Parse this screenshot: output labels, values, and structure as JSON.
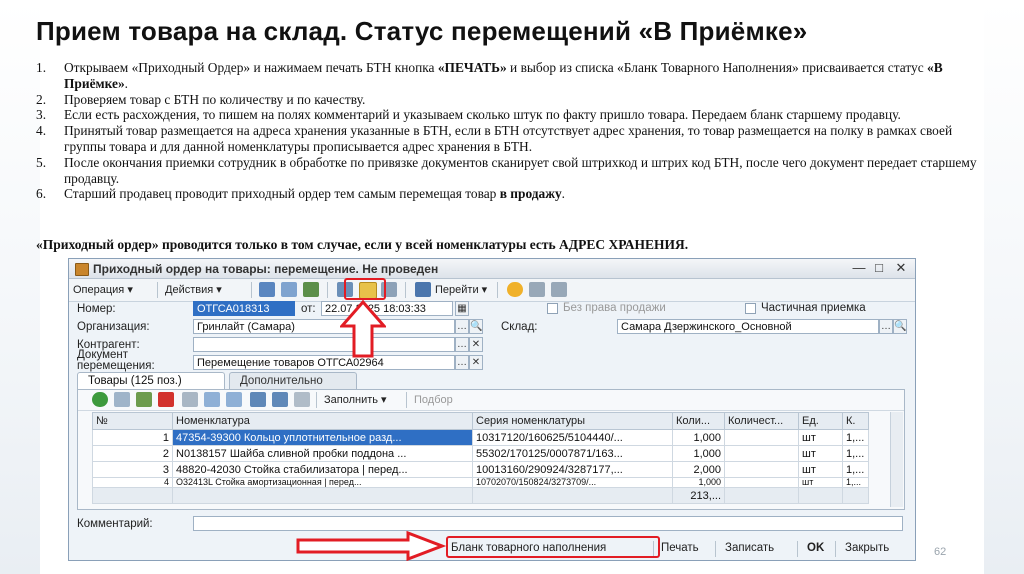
{
  "slide": {
    "title": "Прием товара на склад. Статус перемещений «В Приёмке»",
    "page_number": "62",
    "note": "«Приходный ордер» проводится только в том случае, если у всей номенклатуры есть АДРЕС ХРАНЕНИЯ.",
    "steps": [
      {
        "num": "1.",
        "pre": "Открываем «Приходный Ордер» и нажимаем печать БТН кнопка ",
        "bold1": "«ПЕЧАТЬ»",
        "mid": " и выбор из списка «Бланк Товарного Наполнения» присваивается статус ",
        "bold2": "«В Приёмке»",
        "post": "."
      },
      {
        "num": "2.",
        "text": "Проверяем товар с БТН по количеству и по качеству."
      },
      {
        "num": "3.",
        "text": "Если есть расхождения, то пишем на полях комментарий и указываем сколько штук по факту пришло товара. Передаем бланк старшему продавцу."
      },
      {
        "num": "4.",
        "text": "Принятый товар размещается на адреса хранения указанные в БТН, если в БТН отсутствует адрес хранения, то товар размещается на полку в рамках своей группы товара и для данной номенклатуры прописывается адрес хранения в БТН."
      },
      {
        "num": "5.",
        "text": "После окончания приемки сотрудник в обработке по привязке документов сканирует свой штрихкод и штрих код БТН, после чего документ передает старшему продавцу."
      },
      {
        "num": "6.",
        "pre": "Старший продавец проводит приходный ордер тем самым перемещая товар ",
        "bold1": "в продажу",
        "post": "."
      }
    ]
  },
  "window": {
    "title": "Приходный ордер на товары: перемещение. Не проведен",
    "controls": [
      "—",
      "□",
      "✕"
    ],
    "toolbar": {
      "operation": "Операция ▾",
      "actions": "Действия ▾",
      "goto": "Перейти ▾"
    },
    "form": {
      "number_label": "Номер:",
      "number_value": "ОТГСА018313",
      "from_label": "от:",
      "date_value": "22.07.2025 18:03:33",
      "no_sale_label": "Без права продажи",
      "partial_label": "Частичная приемка",
      "org_label": "Организация:",
      "org_value": "Гринлайт (Самара)",
      "warehouse_label": "Склад:",
      "warehouse_value": "Самара Дзержинского_Основной",
      "counterparty_label": "Контрагент:",
      "counterparty_value": "",
      "doc_label_1": "Документ",
      "doc_label_2": "перемещения:",
      "doc_value": "Перемещение товаров ОТГСА02964"
    },
    "tabs": [
      {
        "label": "Товары (125 поз.)",
        "active": true
      },
      {
        "label": "Дополнительно",
        "active": false
      }
    ],
    "table_toolbar": {
      "fill": "Заполнить ▾",
      "select": "Подбор"
    },
    "table": {
      "columns": [
        "№",
        "Номенклатура",
        "Серия номенклатуры",
        "Коли...",
        "Количест...",
        "Ед.",
        "К."
      ],
      "rows": [
        [
          "1",
          "47354-39300 Кольцо уплотнительное разд...",
          "10317120/160625/5104440/...",
          "1,000",
          "",
          "шт",
          "1,..."
        ],
        [
          "2",
          "N0138157 Шайба сливной пробки поддона ...",
          "55302/170125/0007871/163...",
          "1,000",
          "",
          "шт",
          "1,..."
        ],
        [
          "3",
          "48820-42030 Стойка стабилизатора | перед...",
          "10013160/290924/3287177,...",
          "2,000",
          "",
          "шт",
          "1,..."
        ],
        [
          "4",
          "O32413L Стойка амортизационная | перед...",
          "10702070/150824/3273709/...",
          "1,000",
          "",
          "шт",
          "1,..."
        ]
      ],
      "total": "213,..."
    },
    "comment_label": "Комментарий:",
    "comment_value": "",
    "bottom_buttons": {
      "blank": "Бланк товарного наполнения",
      "print": "Печать",
      "save": "Записать",
      "ok": "OK",
      "close": "Закрыть"
    }
  },
  "colors": {
    "highlight": "#e21c24",
    "selection": "#2f6fc4"
  }
}
